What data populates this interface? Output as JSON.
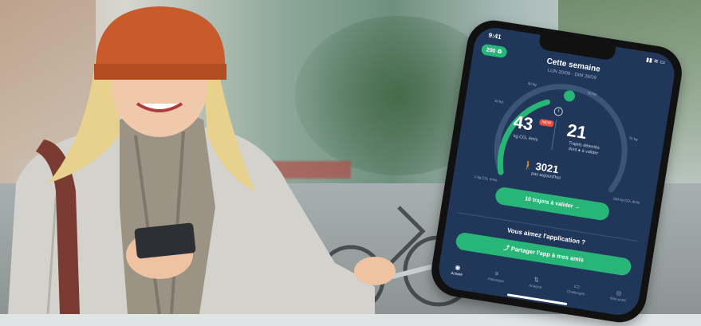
{
  "phone": {
    "status_time": "9:41",
    "status_icons": "▮▮ ≋ ▭",
    "co2_badge": "200 ♻",
    "title": "Cette semaine",
    "date_range": "LUN 20/09 - DIM 26/09",
    "co2_value": "43",
    "co2_tag": "NEW",
    "co2_unit": "kg CO₂ émis",
    "trips_value": "21",
    "trips_label": "Trajets détectés",
    "trips_sub": "dont ● à valider",
    "steps_value": "3021",
    "steps_label": "pas aujourd'hui",
    "validate_button": "10 trajets à valider  →",
    "question": "Vous aimez l'application ?",
    "share_button": "Partager l'app à mes amis",
    "tabs": [
      {
        "label": "Activité",
        "icon": "activity-icon",
        "glyph": "◉"
      },
      {
        "label": "Historique",
        "icon": "history-icon",
        "glyph": "≡"
      },
      {
        "label": "Analyse",
        "icon": "analysis-icon",
        "glyph": "⇅"
      },
      {
        "label": "Challenges",
        "icon": "challenges-icon",
        "glyph": "▭"
      },
      {
        "label": "Mon profil",
        "icon": "profile-icon",
        "glyph": "◎"
      }
    ],
    "gauge_ticks": [
      "40 kg",
      "20 kg",
      "10 kg",
      "75 kg",
      "1 kg CO₂ émis",
      "150 kg CO₂ émis"
    ]
  }
}
